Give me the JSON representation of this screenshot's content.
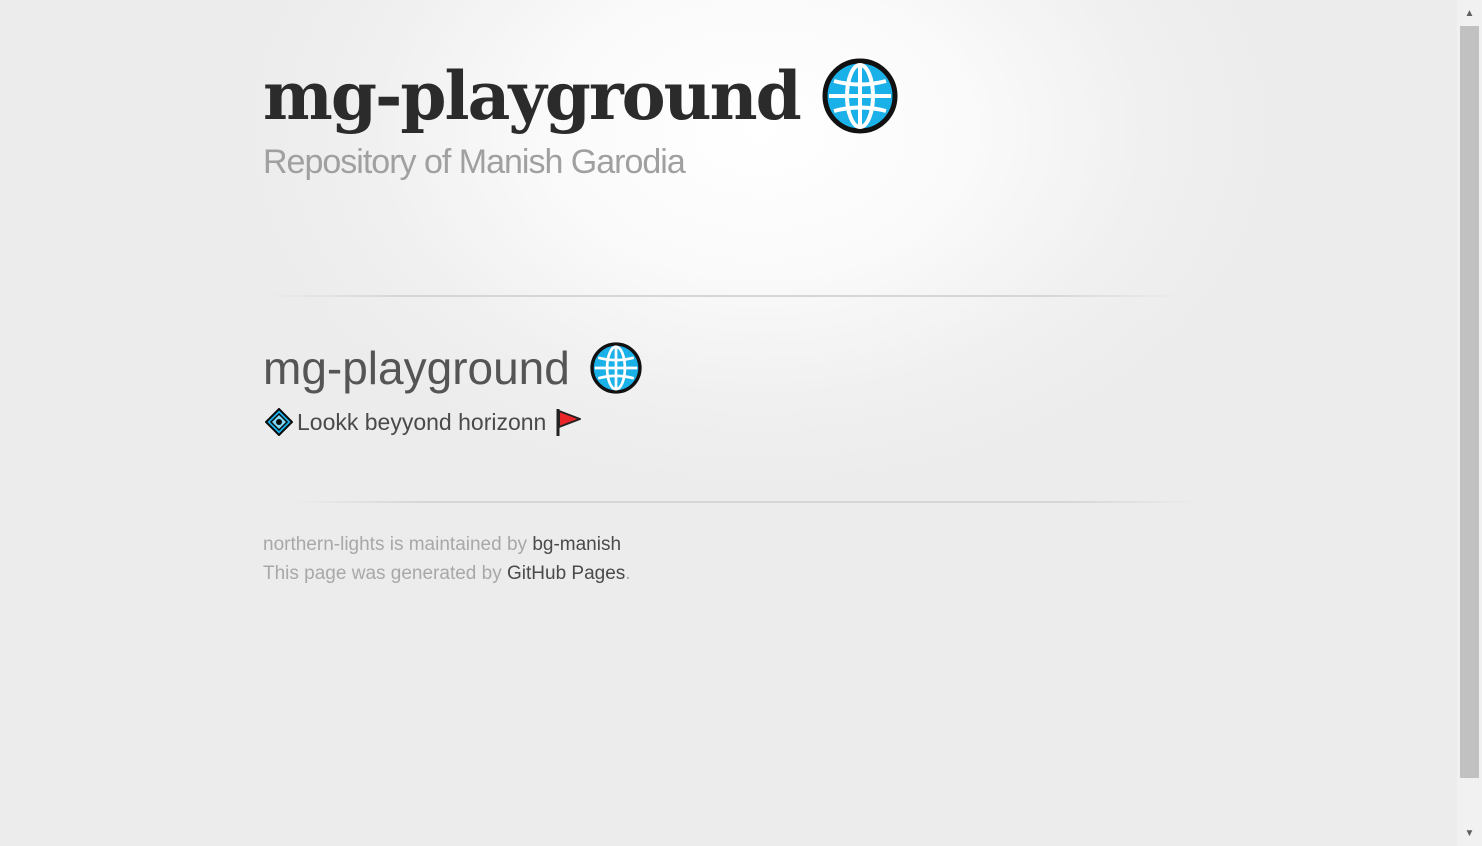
{
  "header": {
    "title": "mg-playground",
    "tagline": "Repository of Manish Garodia"
  },
  "main": {
    "heading": "mg-playground",
    "subline": "Lookk beyyond horizonn"
  },
  "footer": {
    "line1_prefix": "northern-lights is maintained by ",
    "line1_link": "bg-manish",
    "line2_prefix": "This page was generated by ",
    "line2_link": "GitHub Pages",
    "line2_suffix": "."
  },
  "icons": {
    "globe": "globe-icon",
    "diamond": "diamond-with-dot-icon",
    "flag": "triangular-flag-icon"
  },
  "colors": {
    "title": "#2b2b2b",
    "tagline": "#a0a0a0",
    "heading": "#555555",
    "footer_text": "#a8a8a8",
    "footer_link": "#4a4a4a",
    "globe_blue": "#1ab0e8"
  }
}
